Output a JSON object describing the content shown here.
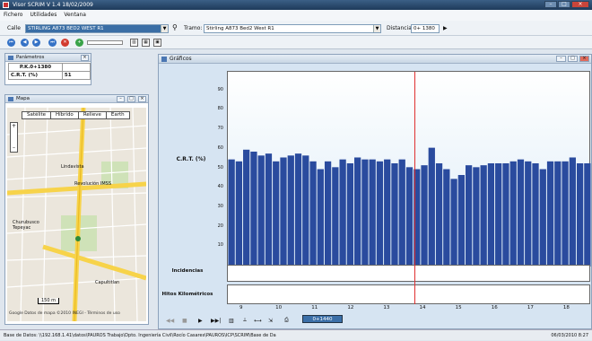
{
  "window": {
    "title": "Visor SCRIM V 1.4 18/02/2009"
  },
  "menu": [
    "Fichero",
    "Utilidades",
    "Ventana"
  ],
  "toolbar": {
    "calle_label": "Calle",
    "calle_value": "STIRLING A873 BED2 WEST R1",
    "tramo_label": "Tramo:",
    "tramo_value": "Stirling A873 Bed2 West R1",
    "distancia_label": "Distancia:",
    "distancia_value": "0+ 1380"
  },
  "parametros": {
    "title": "Parámetros",
    "pk_label": "P.K.0+1380",
    "crt_label": "C.R.T. (%)",
    "crt_value": "51"
  },
  "mapa": {
    "title": "Mapa",
    "buttons": [
      "Satélite",
      "Híbrido",
      "Relieve",
      "Earth"
    ],
    "labels": [
      "Revolución IMSS",
      "Churubusco Tepeyac",
      "Lindavista",
      "Capultitlan"
    ],
    "scale": "150 m",
    "footer": "Google   Datos de mapa ©2010 INEGI - Términos de uso"
  },
  "graficos": {
    "title": "Gráficos",
    "ylabel": "C.R.T. (%)",
    "incidencias_label": "Incidencias",
    "hitos_label": "Hitos Kilométricos",
    "position_value": "0+1440"
  },
  "chart_data": {
    "type": "bar",
    "ylabel": "C.R.T. (%)",
    "ylim": [
      0,
      100
    ],
    "yticks": [
      10,
      20,
      30,
      40,
      50,
      60,
      70,
      80,
      90
    ],
    "xticks": [
      "9",
      "10",
      "11",
      "12",
      "13",
      "14",
      "15",
      "16",
      "17",
      "18"
    ],
    "xlim": [
      8.6,
      18.7
    ],
    "values": [
      55,
      54,
      60,
      59,
      57,
      58,
      54,
      56,
      57,
      58,
      57,
      54,
      50,
      54,
      51,
      55,
      53,
      56,
      55,
      55,
      54,
      55,
      53,
      55,
      51,
      50,
      52,
      61,
      53,
      50,
      45,
      47,
      52,
      51,
      52,
      53,
      53,
      53,
      54,
      55,
      54,
      53,
      50,
      54,
      54,
      54,
      56,
      53,
      53
    ],
    "cursor_x": 13.8,
    "colors": {
      "bar": "#2a4b9e",
      "cursor": "#e03030"
    }
  },
  "status": {
    "left": "Base de Datos: \\\\192.168.1.41\\datos\\PAUROS Trabajo\\Dpto. Ingeniería Civil\\Rocío Casares\\PAUROS\\ICP\\SCRIM\\Base de Da",
    "right": "06/03/2010  8:27"
  }
}
